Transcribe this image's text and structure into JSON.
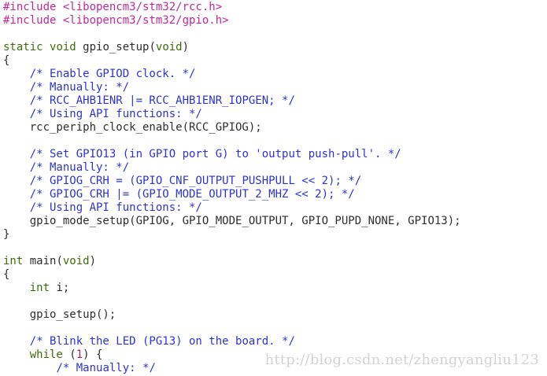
{
  "theme": {
    "colors": {
      "default": "#2e2e2e",
      "preproc": "#c2289c",
      "keyword": "#3b6e0a",
      "comment": "#2c33d6",
      "number": "#b11d63"
    }
  },
  "code_lines": [
    [
      {
        "text": "#include ",
        "type": "preproc"
      },
      {
        "text": "<libopencm3/stm32/rcc.h>",
        "type": "preproc"
      }
    ],
    [
      {
        "text": "#include ",
        "type": "preproc"
      },
      {
        "text": "<libopencm3/stm32/gpio.h>",
        "type": "preproc"
      }
    ],
    [],
    [
      {
        "text": "static",
        "type": "keyword"
      },
      {
        "text": " ",
        "type": "default"
      },
      {
        "text": "void",
        "type": "keyword"
      },
      {
        "text": " gpio_setup(",
        "type": "default"
      },
      {
        "text": "void",
        "type": "keyword"
      },
      {
        "text": ")",
        "type": "default"
      }
    ],
    [
      {
        "text": "{",
        "type": "default"
      }
    ],
    [
      {
        "text": "    ",
        "type": "default"
      },
      {
        "text": "/* Enable GPIOD clock. */",
        "type": "comment"
      }
    ],
    [
      {
        "text": "    ",
        "type": "default"
      },
      {
        "text": "/* Manually: */",
        "type": "comment"
      }
    ],
    [
      {
        "text": "    ",
        "type": "default"
      },
      {
        "text": "/* RCC_AHB1ENR |= RCC_AHB1ENR_IOPGEN; */",
        "type": "comment"
      }
    ],
    [
      {
        "text": "    ",
        "type": "default"
      },
      {
        "text": "/* Using API functions: */",
        "type": "comment"
      }
    ],
    [
      {
        "text": "    rcc_periph_clock_enable(RCC_GPIOG);",
        "type": "default"
      }
    ],
    [],
    [
      {
        "text": "    ",
        "type": "default"
      },
      {
        "text": "/* Set GPIO13 (in GPIO port G) to 'output push-pull'. */",
        "type": "comment"
      }
    ],
    [
      {
        "text": "    ",
        "type": "default"
      },
      {
        "text": "/* Manually: */",
        "type": "comment"
      }
    ],
    [
      {
        "text": "    ",
        "type": "default"
      },
      {
        "text": "/* GPIOG_CRH = (GPIO_CNF_OUTPUT_PUSHPULL << 2); */",
        "type": "comment"
      }
    ],
    [
      {
        "text": "    ",
        "type": "default"
      },
      {
        "text": "/* GPIOG_CRH |= (GPIO_MODE_OUTPUT_2_MHZ << 2); */",
        "type": "comment"
      }
    ],
    [
      {
        "text": "    ",
        "type": "default"
      },
      {
        "text": "/* Using API functions: */",
        "type": "comment"
      }
    ],
    [
      {
        "text": "    gpio_mode_setup(GPIOG, GPIO_MODE_OUTPUT, GPIO_PUPD_NONE, GPIO13);",
        "type": "default"
      }
    ],
    [
      {
        "text": "}",
        "type": "default"
      }
    ],
    [],
    [
      {
        "text": "int",
        "type": "keyword"
      },
      {
        "text": " main(",
        "type": "default"
      },
      {
        "text": "void",
        "type": "keyword"
      },
      {
        "text": ")",
        "type": "default"
      }
    ],
    [
      {
        "text": "{",
        "type": "default"
      }
    ],
    [
      {
        "text": "    ",
        "type": "default"
      },
      {
        "text": "int",
        "type": "keyword"
      },
      {
        "text": " i;",
        "type": "default"
      }
    ],
    [],
    [
      {
        "text": "    gpio_setup();",
        "type": "default"
      }
    ],
    [],
    [
      {
        "text": "    ",
        "type": "default"
      },
      {
        "text": "/* Blink the LED (PG13) on the board. */",
        "type": "comment"
      }
    ],
    [
      {
        "text": "    ",
        "type": "default"
      },
      {
        "text": "while",
        "type": "keyword"
      },
      {
        "text": " (",
        "type": "default"
      },
      {
        "text": "1",
        "type": "number"
      },
      {
        "text": ") {",
        "type": "default"
      }
    ],
    [
      {
        "text": "        ",
        "type": "default"
      },
      {
        "text": "/* Manually: */",
        "type": "comment"
      }
    ]
  ],
  "watermark": {
    "text": "http://blog.csdn.net/zhengyangliu123"
  }
}
